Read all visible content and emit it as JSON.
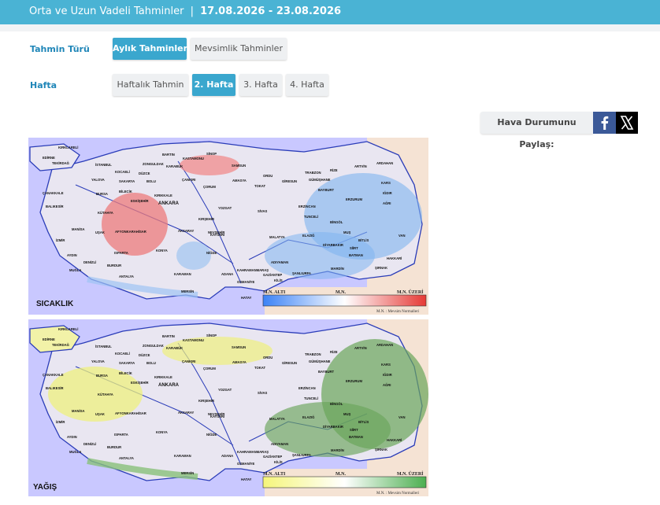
{
  "header": {
    "title": "Orta ve Uzun Vadeli Tahminler",
    "separator": "|",
    "date_range": "17.08.2026 - 23.08.2026"
  },
  "forecast_type": {
    "label": "Tahmin Türü",
    "options": [
      "Aylık Tahminler",
      "Mevsimlik Tahminler"
    ],
    "selected": "Aylık Tahminler"
  },
  "week": {
    "label": "Hafta",
    "options": [
      "Haftalık Tahmin",
      "2. Hafta",
      "3. Hafta",
      "4. Hafta"
    ],
    "selected": "2. Hafta"
  },
  "share": {
    "label": "Hava Durumunu Paylaş:",
    "icons": [
      "facebook-icon",
      "x-icon"
    ]
  },
  "maps": [
    {
      "title": "SICAKLIK",
      "legend": {
        "left": "M.N. ALTI",
        "middle": "M.N.",
        "right": "M.N. ÜZERİ",
        "note": "M.N. : Mevsim Normalleri"
      },
      "colors": {
        "low": "#3b82f6",
        "mid": "#ffffff",
        "high": "#e53935"
      }
    },
    {
      "title": "YAĞIŞ",
      "legend": {
        "left": "M.N. ALTI",
        "middle": "M.N.",
        "right": "M.N. ÜZERİ",
        "note": "M.N. : Mevsim Normalleri"
      },
      "colors": {
        "low": "#f5f57a",
        "mid": "#ffffff",
        "high": "#4caf50"
      }
    }
  ],
  "provinces": [
    "KIRKLARELİ",
    "EDİRNE",
    "TEKİRDAĞ",
    "İSTANBUL",
    "KOCAELİ",
    "SAKARYA",
    "DÜZCE",
    "YALOVA",
    "ZONGULDAK",
    "BARTIN",
    "KARABÜK",
    "KASTAMONU",
    "SİNOP",
    "BOLU",
    "ÇANAKKALE",
    "BALIKESİR",
    "BURSA",
    "BİLECİK",
    "ESKİŞEHİR",
    "KÜTAHYA",
    "ÇANKIRI",
    "ÇORUM",
    "SAMSUN",
    "AMASYA",
    "TOKAT",
    "ORDU",
    "GİRESUN",
    "TRABZON",
    "RİZE",
    "ARTVİN",
    "ARDAHAN",
    "KARS",
    "IĞDIR",
    "AĞRI",
    "GÜMÜŞHANE",
    "BAYBURT",
    "ERZURUM",
    "ERZİNCAN",
    "TUNCELİ",
    "BİNGÖL",
    "MUŞ",
    "VAN",
    "BİTLİS",
    "HAKKARİ",
    "ŞIRNAK",
    "SİİRT",
    "BATMAN",
    "MARDİN",
    "DİYARBAKIR",
    "ELAZIĞ",
    "MALATYA",
    "ADIYAMAN",
    "ŞANLIURFA",
    "GAZİANTEP",
    "KİLİS",
    "HATAY",
    "OSMANİYE",
    "ADANA",
    "MERSİN",
    "KARAMAN",
    "KONYA",
    "ANTALYA",
    "BURDUR",
    "ISPARTA",
    "AFYONKARAHİSAR",
    "UŞAK",
    "MANİSA",
    "İZMİR",
    "AYDIN",
    "MUĞLA",
    "DENİZLİ",
    "ANKARA",
    "KIRIKKALE",
    "KIRŞEHİR",
    "YOZGAT",
    "SİVAS",
    "KAYSERİ",
    "NEVŞEHİR",
    "NİĞDE",
    "AKSARAY",
    "KAHRAMANMARAŞ"
  ]
}
